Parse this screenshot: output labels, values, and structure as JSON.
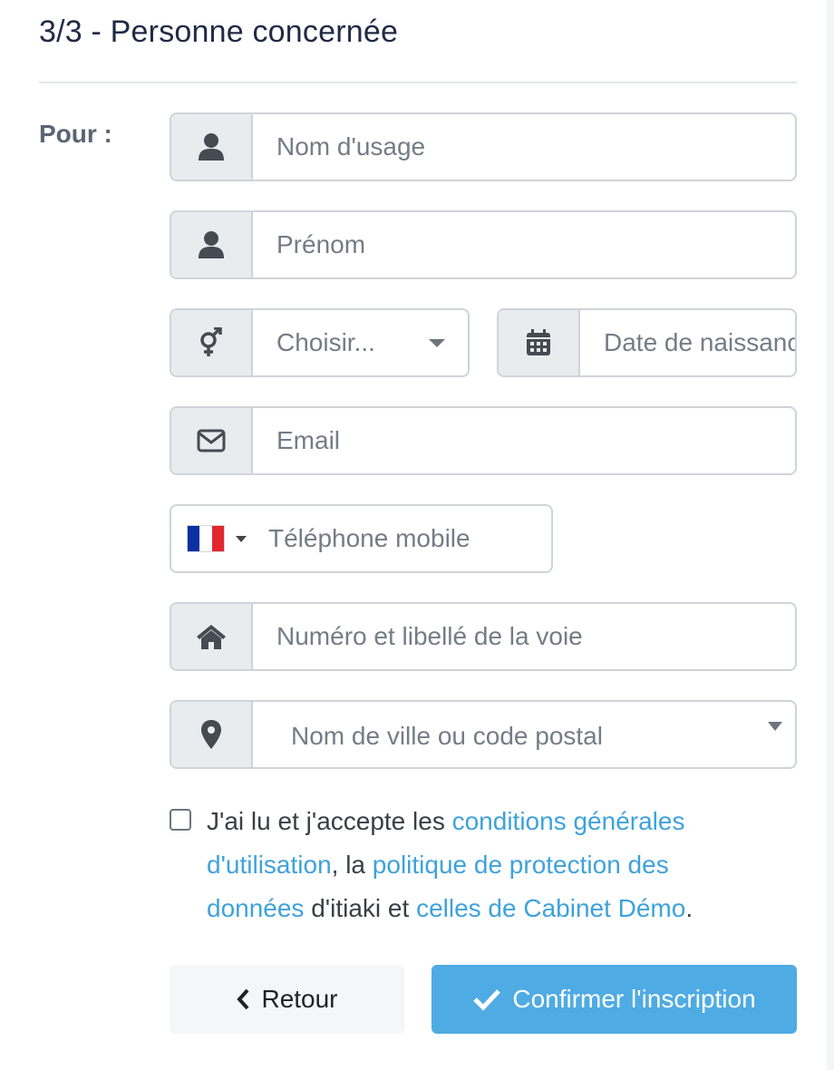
{
  "header": {
    "title": "3/3 - Personne concernée"
  },
  "form": {
    "for_label": "Pour :",
    "last_name_placeholder": "Nom d'usage",
    "first_name_placeholder": "Prénom",
    "gender_select_value": "Choisir...",
    "birth_date_placeholder": "Date de naissance",
    "email_placeholder": "Email",
    "phone": {
      "country_flag": "France",
      "flag_colors": [
        "#0a2fa3",
        "#ffffff",
        "#e3262e"
      ],
      "placeholder": "Téléphone mobile"
    },
    "address_placeholder": "Numéro et libellé de la voie",
    "city_placeholder": "Nom de ville ou code postal"
  },
  "consent": {
    "checked": false,
    "text_1": "J'ai lu et j'accepte les ",
    "link_cgu": "conditions générales d'utilisation",
    "text_2": ", la ",
    "link_privacy": "politique de protection des données",
    "text_3": " d'itiaki et ",
    "link_cabinet": "celles de Cabinet Démo",
    "text_4": "."
  },
  "buttons": {
    "back_label": "Retour",
    "confirm_label": "Confirmer l'inscription"
  },
  "colors": {
    "accent": "#4fabe3",
    "link": "#3ea2dc",
    "title": "#212b45"
  },
  "icons": [
    "user-icon",
    "user-icon",
    "venus-mars-icon",
    "calendar-icon",
    "envelope-icon",
    "home-icon",
    "map-marker-icon",
    "chevron-left-icon",
    "check-icon"
  ]
}
